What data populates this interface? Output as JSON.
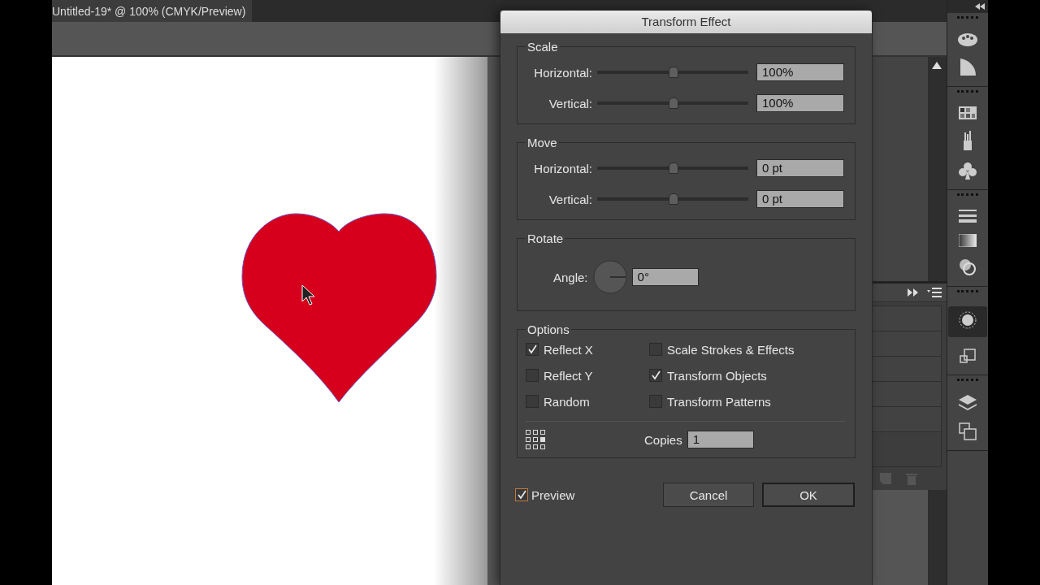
{
  "document_tab": {
    "title": "Untitled-19* @ 100% (CMYK/Preview)"
  },
  "dialog": {
    "title": "Transform Effect",
    "scale": {
      "title": "Scale",
      "rows": [
        {
          "label": "Horizontal:",
          "level": 0.5,
          "value": "100%"
        },
        {
          "label": "Vertical:",
          "level": 0.5,
          "value": "100%"
        }
      ]
    },
    "move": {
      "title": "Move",
      "rows": [
        {
          "label": "Horizontal:",
          "level": 0.5,
          "value": "0 pt"
        },
        {
          "label": "Vertical:",
          "level": 0.5,
          "value": "0 pt"
        }
      ]
    },
    "rotate": {
      "title": "Rotate",
      "angle_label": "Angle:",
      "angle_value": "0°"
    },
    "options": {
      "title": "Options",
      "checkboxes": [
        {
          "label": "Reflect X",
          "checked": true
        },
        {
          "label": "Scale Strokes & Effects",
          "checked": false
        },
        {
          "label": "Reflect Y",
          "checked": false
        },
        {
          "label": "Transform Objects",
          "checked": true
        },
        {
          "label": "Random",
          "checked": false
        },
        {
          "label": "Transform Patterns",
          "checked": false
        }
      ],
      "copies_label": "Copies",
      "copies_value": "1"
    },
    "preview": {
      "label": "Preview",
      "checked": true
    },
    "buttons": [
      {
        "label": "Cancel",
        "default": false
      },
      {
        "label": "OK",
        "default": true
      }
    ]
  }
}
